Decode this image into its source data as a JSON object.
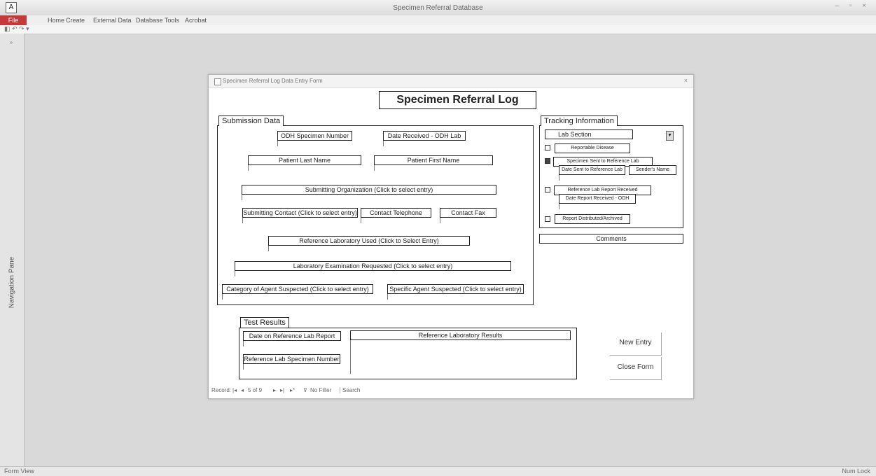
{
  "window": {
    "title": "Specimen Referral Database",
    "app_icon": "A",
    "controls": "– ▫ ×"
  },
  "ribbon": {
    "file_tab": "File",
    "tabs": [
      "Home",
      "Create",
      "External Data",
      "Database Tools",
      "Acrobat"
    ]
  },
  "qat": {
    "text": "◧ ↶ ↷ ▾"
  },
  "nav_pane": {
    "label": "Navigation Pane",
    "toggle": "»"
  },
  "status_bar": {
    "left": "Form View",
    "right": "Num Lock"
  },
  "form": {
    "caption": "Specimen Referral Log Data Entry Form",
    "close": "×",
    "title": "Specimen Referral Log",
    "submission_tab": "Submission Data",
    "fields": {
      "odh_specimen_number": "ODH Specimen Number",
      "date_received": "Date Received - ODH Lab",
      "patient_last_name": "Patient Last Name",
      "patient_first_name": "Patient First Name",
      "submitting_org": "Submitting Organization     (Click to select entry)",
      "submitting_contact": "Submitting Contact   (Click to select entry)",
      "contact_telephone": "Contact Telephone",
      "contact_fax": "Contact Fax",
      "reference_lab_used": "Reference Laboratory Used   (Click to Select Entry)",
      "lab_exam_requested": "Laboratory Examination Requested     (Click to select entry)",
      "category_agent": "Category of Agent Suspected   (Click to select entry)",
      "specific_agent": "Specific Agent Suspected   (Click to select entry)"
    },
    "tracking": {
      "tab": "Tracking Information",
      "lab_section": "Lab Section",
      "reportable_disease": "Reportable Disease",
      "specimen_sent": "Specimen Sent to Reference Lab",
      "date_sent": "Date Sent to Reference Lab",
      "senders_name": "Sender's Name",
      "report_received": "Reference Lab Report Received",
      "date_report_received": "Date Report Received - ODH",
      "report_distributed": "Report Distributed/Archived"
    },
    "comments": "Comments",
    "test_results": {
      "tab": "Test Results",
      "date_on_report": "Date on Reference Lab Report",
      "ref_lab_results": "Reference Laboratory Results",
      "ref_lab_specimen_number": "Reference Lab Specimen Number"
    },
    "buttons": {
      "new_entry": "New Entry",
      "close_form": "Close Form"
    },
    "record_nav": {
      "label": "Record:",
      "position": "5 of 9",
      "filter": "No Filter",
      "search": "Search"
    }
  }
}
